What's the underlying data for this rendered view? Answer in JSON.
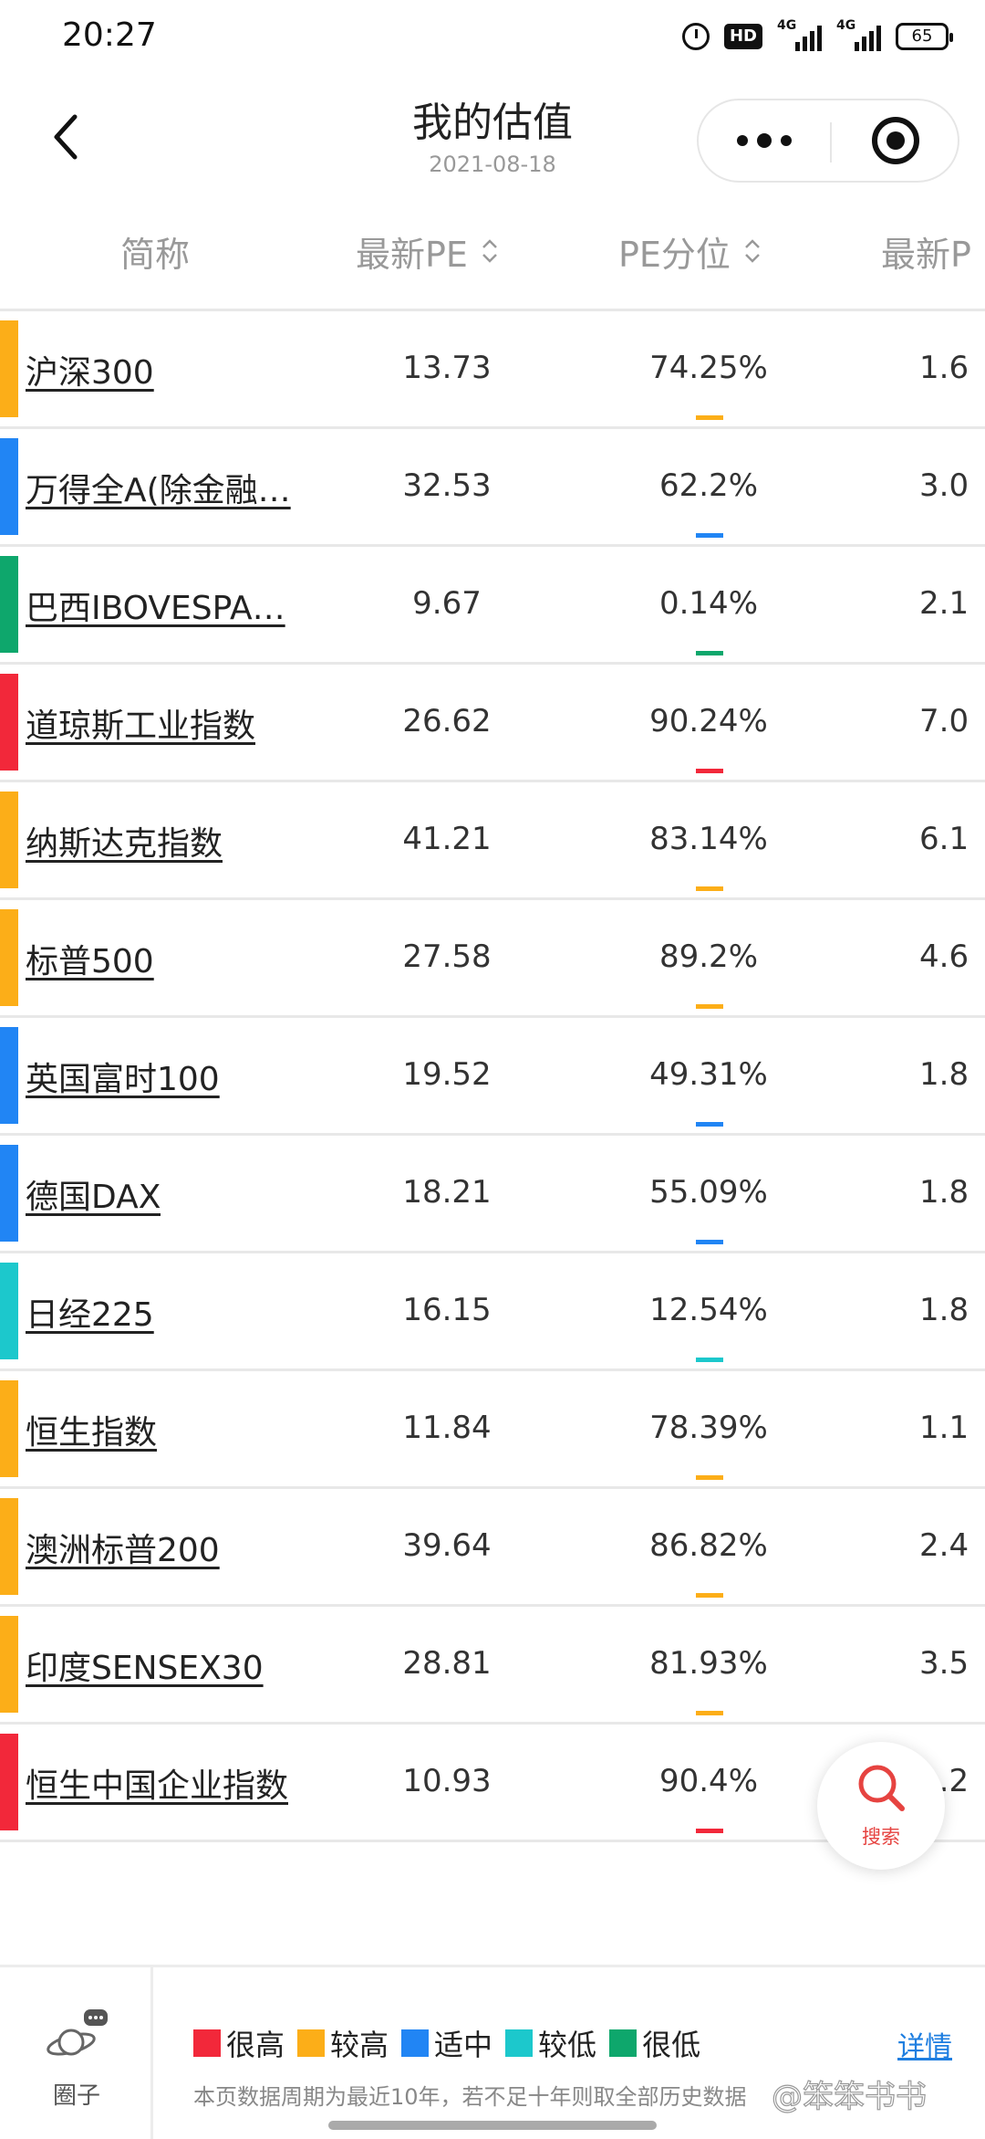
{
  "status": {
    "time": "20:27",
    "battery": "65",
    "net1": "4G",
    "net2": "4G",
    "hd": "HD"
  },
  "nav": {
    "title": "我的估值",
    "date": "2021-08-18"
  },
  "columns": {
    "name": "简称",
    "pe": "最新PE",
    "pe_pct": "PE分位",
    "pb": "最新P"
  },
  "rows": [
    {
      "name": "沪深300",
      "pe": "13.73",
      "pct": "74.25%",
      "pb": "1.6",
      "level_color": "#fcae18"
    },
    {
      "name": "万得全A(除金融…",
      "pe": "32.53",
      "pct": "62.2%",
      "pb": "3.0",
      "level_color": "#2185f4"
    },
    {
      "name": "巴西IBOVESPA…",
      "pe": "9.67",
      "pct": "0.14%",
      "pb": "2.1",
      "level_color": "#0ea76c"
    },
    {
      "name": "道琼斯工业指数",
      "pe": "26.62",
      "pct": "90.24%",
      "pb": "7.0",
      "level_color": "#f2283a"
    },
    {
      "name": "纳斯达克指数",
      "pe": "41.21",
      "pct": "83.14%",
      "pb": "6.1",
      "level_color": "#fcae18"
    },
    {
      "name": "标普500",
      "pe": "27.58",
      "pct": "89.2%",
      "pb": "4.6",
      "level_color": "#fcae18"
    },
    {
      "name": "英国富时100",
      "pe": "19.52",
      "pct": "49.31%",
      "pb": "1.8",
      "level_color": "#2185f4"
    },
    {
      "name": "德国DAX",
      "pe": "18.21",
      "pct": "55.09%",
      "pb": "1.8",
      "level_color": "#2185f4"
    },
    {
      "name": "日经225",
      "pe": "16.15",
      "pct": "12.54%",
      "pb": "1.8",
      "level_color": "#1cc8cc"
    },
    {
      "name": "恒生指数",
      "pe": "11.84",
      "pct": "78.39%",
      "pb": "1.1",
      "level_color": "#fcae18"
    },
    {
      "name": "澳洲标普200",
      "pe": "39.64",
      "pct": "86.82%",
      "pb": "2.4",
      "level_color": "#fcae18"
    },
    {
      "name": "印度SENSEX30",
      "pe": "28.81",
      "pct": "81.93%",
      "pb": "3.5",
      "level_color": "#fcae18"
    },
    {
      "name": "恒生中国企业指数",
      "pe": "10.93",
      "pct": "90.4%",
      "pb": "1.2",
      "level_color": "#f2283a"
    }
  ],
  "fab": {
    "label": "搜索",
    "icon": "search-icon"
  },
  "footer": {
    "circle_label": "圈子",
    "legend": [
      {
        "label": "很高",
        "color": "#f2283a"
      },
      {
        "label": "较高",
        "color": "#fcae18"
      },
      {
        "label": "适中",
        "color": "#2185f4"
      },
      {
        "label": "较低",
        "color": "#1cc8cc"
      },
      {
        "label": "很低",
        "color": "#0ea76c"
      }
    ],
    "detail": "详情",
    "note": "本页数据周期为最近10年，若不足十年则取全部历史数据",
    "watermark": "@笨笨书书"
  }
}
